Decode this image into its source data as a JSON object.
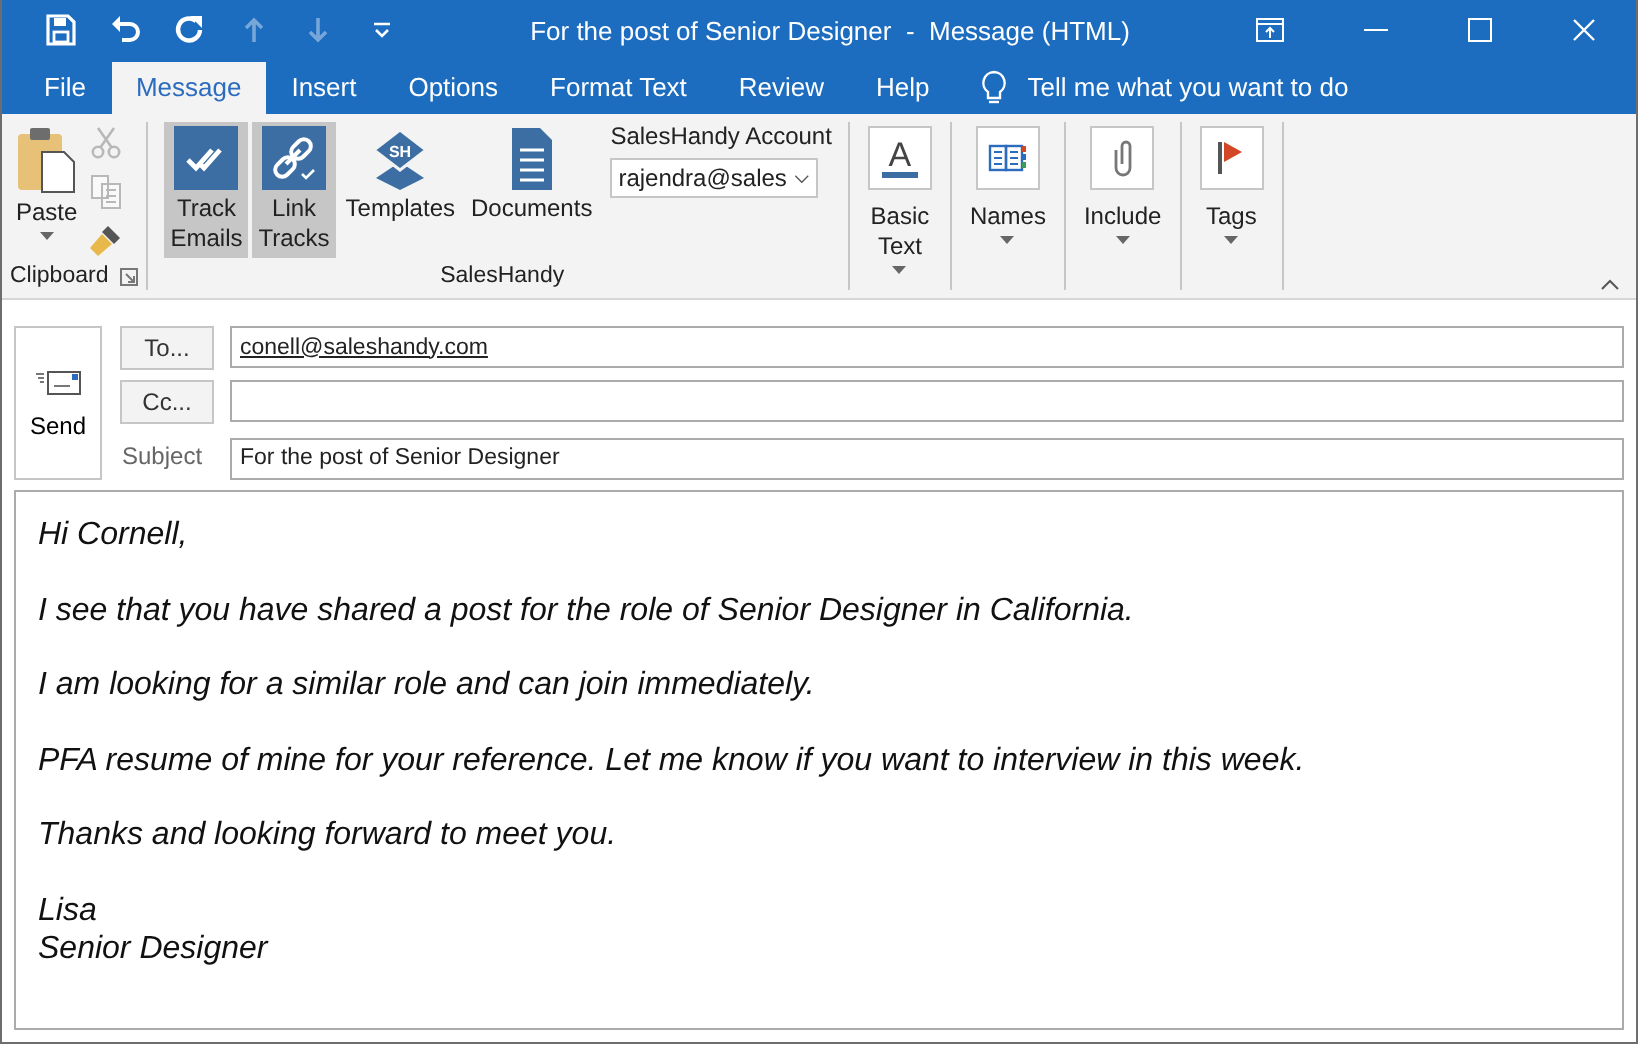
{
  "window": {
    "title": "For the post of Senior Designer  -  Message (HTML)"
  },
  "quick_access": [
    {
      "kind": "save",
      "disabled": false
    },
    {
      "kind": "undo",
      "disabled": false
    },
    {
      "kind": "redo",
      "disabled": false
    },
    {
      "kind": "up",
      "disabled": true
    },
    {
      "kind": "down",
      "disabled": true
    },
    {
      "kind": "customize",
      "disabled": false
    }
  ],
  "tabs": [
    {
      "label": "File",
      "selected": false
    },
    {
      "label": "Message",
      "selected": true
    },
    {
      "label": "Insert",
      "selected": false
    },
    {
      "label": "Options",
      "selected": false
    },
    {
      "label": "Format Text",
      "selected": false
    },
    {
      "label": "Review",
      "selected": false
    },
    {
      "label": "Help",
      "selected": false
    }
  ],
  "tell_me": "Tell me what you want to do",
  "ribbon": {
    "clipboard": {
      "label": "Clipboard",
      "paste": "Paste",
      "tools": [
        {
          "kind": "cut",
          "disabled": true
        },
        {
          "kind": "copy",
          "disabled": true
        },
        {
          "kind": "painter",
          "disabled": false
        }
      ]
    },
    "saleshandy": {
      "label": "SalesHandy",
      "buttons": [
        {
          "kind": "track",
          "label": "Track Emails",
          "selected": true
        },
        {
          "kind": "link",
          "label": "Link Tracks",
          "selected": true
        },
        {
          "kind": "templates",
          "label": "Templates",
          "selected": false,
          "badge": "SH"
        },
        {
          "kind": "documents",
          "label": "Documents",
          "selected": false
        }
      ],
      "account": {
        "label": "SalesHandy Account",
        "value": "rajendra@sales"
      }
    },
    "groups": [
      {
        "kind": "text",
        "label": "Basic Text",
        "glyph": "A"
      },
      {
        "kind": "names",
        "label": "Names"
      },
      {
        "kind": "include",
        "label": "Include"
      },
      {
        "kind": "tags",
        "label": "Tags"
      }
    ]
  },
  "compose": {
    "send": "Send",
    "to": {
      "button": "To...",
      "value": "conell@saleshandy.com"
    },
    "cc": {
      "button": "Cc..."
    },
    "subject": {
      "label": "Subject",
      "value": "For the post of Senior Designer"
    }
  },
  "body": {
    "paragraphs": [
      "Hi Cornell,",
      "I see that you have shared a post for the role of Senior Designer in California.",
      "I am looking for a similar role and can join immediately.",
      "PFA resume of mine for your reference. Let me know if you want to interview in this week.",
      "Thanks and looking forward to meet you.",
      "Lisa\nSenior Designer"
    ]
  }
}
